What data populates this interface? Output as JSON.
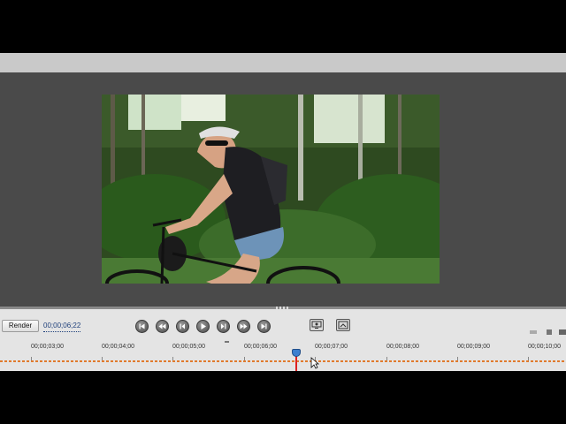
{
  "editor": {
    "render_label": "Render",
    "current_timecode": "00;00;06;22",
    "transport": [
      "go-to-start",
      "previous-edit",
      "step-back",
      "play",
      "step-forward",
      "next-edit",
      "go-to-end"
    ],
    "view_buttons": [
      "safe-margins",
      "fit-to-window"
    ],
    "ruler_labels": [
      "00;00;03;00",
      "00;00;04;00",
      "00;00;05;00",
      "00;00;06;00",
      "00;00;07;00",
      "00;00;08;00",
      "00;00;09;00",
      "00;00;10;00"
    ],
    "playhead_time": "00;00;06;22",
    "accent_playhead": "#3b7fd0",
    "range_color": "#e07a2c"
  }
}
